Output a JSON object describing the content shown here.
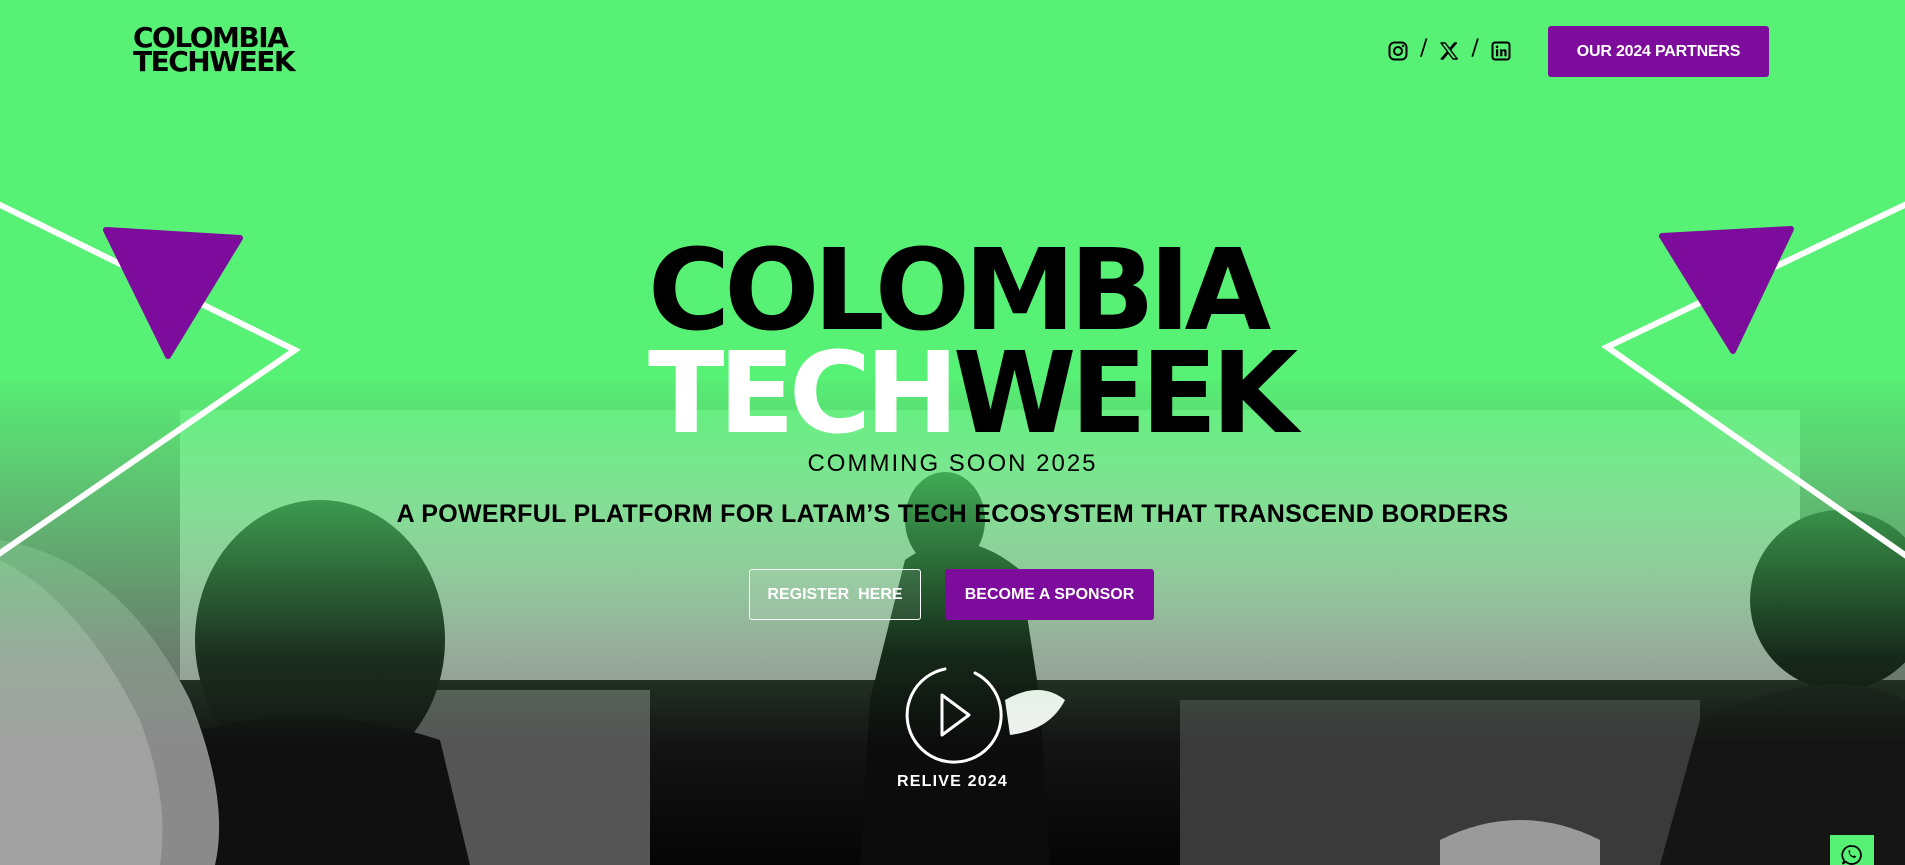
{
  "header": {
    "logo_line1": "COLOMBIA",
    "logo_line2": "TECHWEEK",
    "social_separator": "/",
    "social_icons": [
      "instagram-icon",
      "x-twitter-icon",
      "linkedin-icon"
    ],
    "partners_button": "OUR 2024 PARTNERS"
  },
  "hero": {
    "logo_line1": "COLOMBIA",
    "logo_tech": "TECH",
    "logo_week": "WEEK",
    "coming_soon": "COMMING SOON 2025",
    "tagline": "A POWERFUL PLATFORM FOR LATAM’S TECH ECOSYSTEM THAT TRANSCEND BORDERS",
    "register_button": "REGISTER  HERE",
    "sponsor_button": "BECOME A SPONSOR",
    "play_icon": "play-circle-icon",
    "relive_label": "RELIVE 2024"
  },
  "floating": {
    "whatsapp_icon": "whatsapp-icon"
  },
  "colors": {
    "brand_green": "#57f175",
    "brand_purple": "#7d0b9c",
    "text_dark": "#000000",
    "text_light": "#ffffff"
  }
}
